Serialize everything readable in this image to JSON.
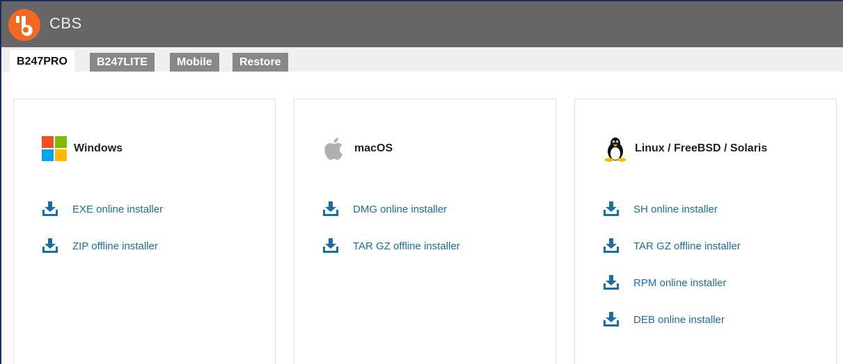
{
  "app": {
    "title": "CBS",
    "accent": "#f26a21",
    "header_bg": "#666666"
  },
  "tabs": [
    {
      "label": "B247PRO",
      "active": true
    },
    {
      "label": "B247LITE",
      "active": false
    },
    {
      "label": "Mobile",
      "active": false
    },
    {
      "label": "Restore",
      "active": false
    }
  ],
  "platforms": [
    {
      "name": "Windows",
      "icon": "windows-icon",
      "downloads": [
        {
          "label": "EXE online installer"
        },
        {
          "label": "ZIP offline installer"
        }
      ]
    },
    {
      "name": "macOS",
      "icon": "apple-icon",
      "downloads": [
        {
          "label": "DMG online installer"
        },
        {
          "label": "TAR GZ offline installer"
        }
      ]
    },
    {
      "name": "Linux / FreeBSD / Solaris",
      "icon": "tux-penguin-icon",
      "downloads": [
        {
          "label": "SH online installer"
        },
        {
          "label": "TAR GZ offline installer"
        },
        {
          "label": "RPM online installer"
        },
        {
          "label": "DEB online installer"
        }
      ]
    }
  ],
  "colors": {
    "link": "#1b6ea3",
    "download_icon": "#1b6ea3"
  }
}
